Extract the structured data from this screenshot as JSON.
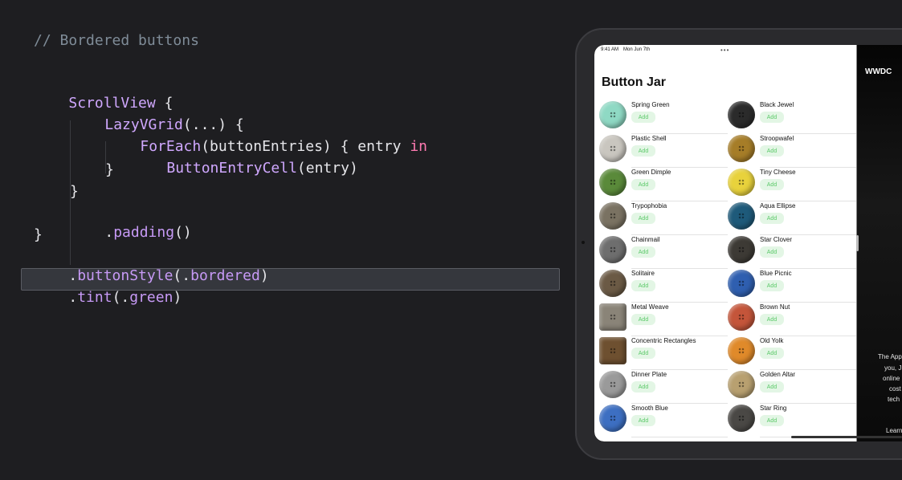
{
  "code": {
    "comment": "// Bordered buttons",
    "l1_type": "ScrollView",
    "l1_rest": " {",
    "l2_type": "LazyVGrid",
    "l2_rest": "(...) {",
    "l3_type": "ForEach",
    "l3_mid": "(buttonEntries) { entry ",
    "l3_kw": "in",
    "l4_type": "ButtonEntryCell",
    "l4_rest": "(entry)",
    "l5": "}",
    "l6": "}",
    "l7_dot": ".",
    "l7_member": "padding",
    "l7_rest": "()",
    "l8": "}",
    "l9_dot": ".",
    "l9_member": "buttonStyle",
    "l9_mid": "(.",
    "l9_member2": "bordered",
    "l9_rest": ")",
    "l10_dot": ".",
    "l10_member": "tint",
    "l10_mid": "(.",
    "l10_member2": "green",
    "l10_rest": ")"
  },
  "ipad": {
    "status_time": "9:41 AM",
    "status_date": "Mon Jun 7th",
    "dots": "•••",
    "title": "Button Jar",
    "add_label": "Add",
    "accent": "#5cc96a",
    "left_column": [
      {
        "name": "Spring Green",
        "color": "#8fd9c4"
      },
      {
        "name": "Plastic Shell",
        "color": "#c9c6bf"
      },
      {
        "name": "Green Dimple",
        "color": "#5a8a3a"
      },
      {
        "name": "Trypophobia",
        "color": "#7a7262"
      },
      {
        "name": "Chainmail",
        "color": "#6e6e6e"
      },
      {
        "name": "Solitaire",
        "color": "#6b5a45"
      },
      {
        "name": "Metal Weave",
        "color": "#8a8478"
      },
      {
        "name": "Concentric Rectangles",
        "color": "#6e5030"
      },
      {
        "name": "Dinner Plate",
        "color": "#9a9a9a"
      },
      {
        "name": "Smooth Blue",
        "color": "#3d6fc2"
      }
    ],
    "right_column": [
      {
        "name": "Black Jewel",
        "color": "#2b2b2b"
      },
      {
        "name": "Stroopwafel",
        "color": "#a67d28"
      },
      {
        "name": "Tiny Cheese",
        "color": "#e8d23c"
      },
      {
        "name": "Aqua Ellipse",
        "color": "#1e5a7a"
      },
      {
        "name": "Star Clover",
        "color": "#3d3a35"
      },
      {
        "name": "Blue Picnic",
        "color": "#2f5fb0"
      },
      {
        "name": "Brown Nut",
        "color": "#c4553a"
      },
      {
        "name": "Old Yolk",
        "color": "#e08a2a"
      },
      {
        "name": "Golden Altar",
        "color": "#b8a070"
      },
      {
        "name": "Star Ring",
        "color": "#4a4845"
      }
    ],
    "side": {
      "logo": " WWDC",
      "lines": [
        "The App",
        "you, J",
        "online",
        "cost",
        "tech",
        "Learn"
      ]
    }
  }
}
